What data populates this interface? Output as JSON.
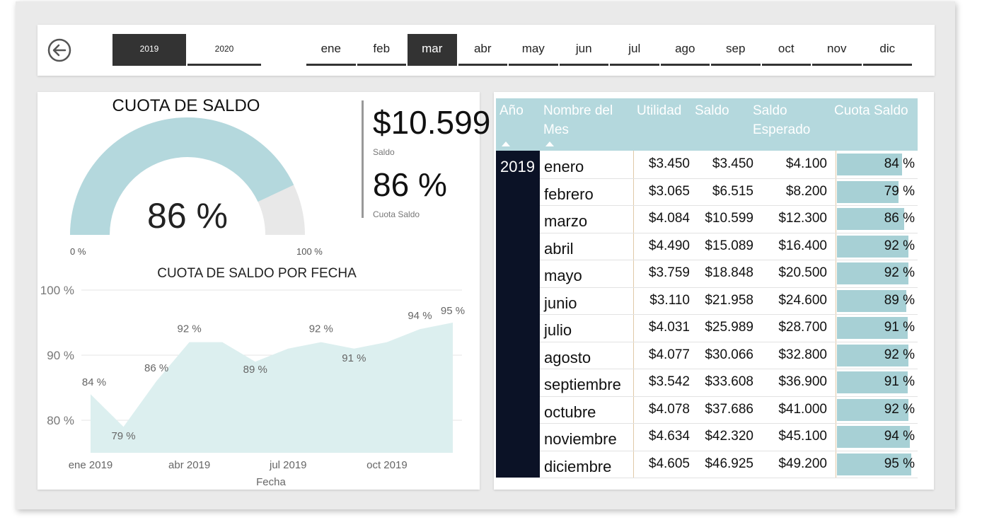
{
  "slicers": {
    "years": [
      {
        "label": "2019",
        "selected": true
      },
      {
        "label": "2020",
        "selected": false
      }
    ],
    "months": [
      {
        "label": "ene",
        "selected": false
      },
      {
        "label": "feb",
        "selected": false
      },
      {
        "label": "mar",
        "selected": true
      },
      {
        "label": "abr",
        "selected": false
      },
      {
        "label": "may",
        "selected": false
      },
      {
        "label": "jun",
        "selected": false
      },
      {
        "label": "jul",
        "selected": false
      },
      {
        "label": "ago",
        "selected": false
      },
      {
        "label": "sep",
        "selected": false
      },
      {
        "label": "oct",
        "selected": false
      },
      {
        "label": "nov",
        "selected": false
      },
      {
        "label": "dic",
        "selected": false
      }
    ]
  },
  "gauge": {
    "title": "CUOTA DE SALDO",
    "value_label": "86 %",
    "value": 0.86,
    "min_label": "0 %",
    "max_label": "100 %",
    "fill_color": "#b4d8dd",
    "track_color": "#e8e8e8"
  },
  "cards": {
    "saldo_value": "$10.599",
    "saldo_label": "Saldo",
    "cuota_value": "86 %",
    "cuota_label": "Cuota Saldo"
  },
  "chart_data": {
    "type": "area",
    "title": "CUOTA DE SALDO POR FECHA",
    "xlabel": "Fecha",
    "ylabel": "",
    "x": [
      "ene 2019",
      "feb 2019",
      "mar 2019",
      "abr 2019",
      "may 2019",
      "jun 2019",
      "jul 2019",
      "ago 2019",
      "sep 2019",
      "oct 2019",
      "nov 2019",
      "dic 2019"
    ],
    "x_ticks": [
      "ene 2019",
      "abr 2019",
      "jul 2019",
      "oct 2019"
    ],
    "values": [
      84,
      79,
      86,
      92,
      92,
      89,
      91,
      92,
      91,
      92,
      94,
      95
    ],
    "data_labels": [
      "84 %",
      "79 %",
      "86 %",
      "92 %",
      "",
      "89 %",
      "",
      "92 %",
      "91 %",
      "",
      "94 %",
      "95 %"
    ],
    "y_ticks": [
      "80 %",
      "90 %",
      "100 %"
    ],
    "ylim": [
      75,
      100
    ],
    "color": "#dcefef"
  },
  "table": {
    "headers": [
      "Año",
      "Nombre del Mes",
      "Utilidad",
      "Saldo",
      "Saldo Esperado",
      "Cuota Saldo"
    ],
    "year": "2019",
    "rows": [
      {
        "mes": "enero",
        "utilidad": "$3.450",
        "saldo": "$3.450",
        "esperado": "$4.100",
        "cuota": "84 %",
        "pct": 84
      },
      {
        "mes": "febrero",
        "utilidad": "$3.065",
        "saldo": "$6.515",
        "esperado": "$8.200",
        "cuota": "79 %",
        "pct": 79
      },
      {
        "mes": "marzo",
        "utilidad": "$4.084",
        "saldo": "$10.599",
        "esperado": "$12.300",
        "cuota": "86 %",
        "pct": 86
      },
      {
        "mes": "abril",
        "utilidad": "$4.490",
        "saldo": "$15.089",
        "esperado": "$16.400",
        "cuota": "92 %",
        "pct": 92
      },
      {
        "mes": "mayo",
        "utilidad": "$3.759",
        "saldo": "$18.848",
        "esperado": "$20.500",
        "cuota": "92 %",
        "pct": 92
      },
      {
        "mes": "junio",
        "utilidad": "$3.110",
        "saldo": "$21.958",
        "esperado": "$24.600",
        "cuota": "89 %",
        "pct": 89
      },
      {
        "mes": "julio",
        "utilidad": "$4.031",
        "saldo": "$25.989",
        "esperado": "$28.700",
        "cuota": "91 %",
        "pct": 91
      },
      {
        "mes": "agosto",
        "utilidad": "$4.077",
        "saldo": "$30.066",
        "esperado": "$32.800",
        "cuota": "92 %",
        "pct": 92
      },
      {
        "mes": "septiembre",
        "utilidad": "$3.542",
        "saldo": "$33.608",
        "esperado": "$36.900",
        "cuota": "91 %",
        "pct": 91
      },
      {
        "mes": "octubre",
        "utilidad": "$4.078",
        "saldo": "$37.686",
        "esperado": "$41.000",
        "cuota": "92 %",
        "pct": 92
      },
      {
        "mes": "noviembre",
        "utilidad": "$4.634",
        "saldo": "$42.320",
        "esperado": "$45.100",
        "cuota": "94 %",
        "pct": 94
      },
      {
        "mes": "diciembre",
        "utilidad": "$4.605",
        "saldo": "$46.925",
        "esperado": "$49.200",
        "cuota": "95 %",
        "pct": 95
      }
    ]
  }
}
